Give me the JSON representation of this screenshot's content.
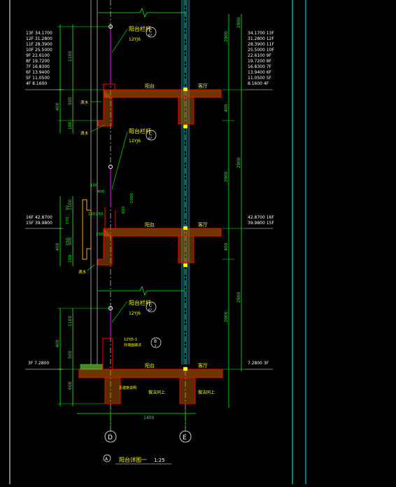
{
  "drawing": {
    "title": "阳台详图一",
    "scale": "1:25",
    "detail_number": "A",
    "colors": {
      "background": "#000000",
      "dimension": "#00ff00",
      "wall_outline": "#ff0000",
      "hatch": "#c86400",
      "label": "#ffff00",
      "axis": "#ffffff",
      "cyan": "#00ffff",
      "magenta": "#ff00ff",
      "blue_line": "#4080ff"
    }
  },
  "levels_left_upper": [
    "13F 34.1700",
    "12F 31.2800",
    "11F 28.3900",
    "10F 25.5000",
    "9F 22.6100",
    "8F 19.7200",
    "7F 16.8300",
    "6F 13.9400",
    "5F 11.0500",
    "4F 8.1600"
  ],
  "levels_right_upper": [
    "34.1700 13F",
    "31.2800 12F",
    "28.3900 11F",
    "25.5000 10F",
    "22.6100 9F",
    "19.7200 8F",
    "16.8300 7F",
    "13.9400 6F",
    "11.0500 5F",
    "8.1600 4F"
  ],
  "levels_left_mid": [
    "16F 42.8700",
    "15F 39.9800"
  ],
  "levels_right_mid": [
    "42.8700 16F",
    "39.9800 15F"
  ],
  "level_bottom_left": "3F 7.2800",
  "level_bottom_right": "7.2800 3F",
  "labels": {
    "railing_1": "阳台栏杆",
    "railing_1_ref": "12YJ6",
    "railing_2": "阳台栏杆",
    "railing_2_ref": "12YJ6",
    "railing_3": "阳台栏杆",
    "railing_3_ref": "12YJ6",
    "balcony_1": "阳台",
    "living_1": "客厅",
    "balcony_2": "阳台",
    "living_2": "客厅",
    "balcony_3": "阳台",
    "living_3": "客厅",
    "drain_1": "滴水",
    "drain_2": "滴水",
    "drain_3": "滴水",
    "bottom_detail": "12YJ5-1",
    "bottom_detail_2": "外墙面做法",
    "ceiling_1": "见建施说明",
    "ceiling_2": "做法同上",
    "ceiling_3": "做法同上",
    "circle_ref_top": "C",
    "circle_ref_top_sub": "67",
    "circle_ref_mid": "C",
    "circle_ref_mid_sub": "67",
    "circle_ref_bot": "C",
    "circle_ref_bot_sub": "67",
    "circle_ref_b": "B",
    "circle_ref_b_sub": "2"
  },
  "dimensions": {
    "right_top": "2900",
    "right_mid": "2900",
    "right_bot": "2900",
    "right_vert_1": "2900",
    "right_vert_2": "2900",
    "right_vert_3": "2900",
    "right_slab_1": "400",
    "right_slab_2": "400",
    "left_1100_a": "1100",
    "left_500_a": "500",
    "left_400_a": "400",
    "left_100_a": "100",
    "left_1100_b": "1100",
    "left_500_b": "500",
    "left_400_b": "400",
    "left_100_b": "100",
    "left_1100_c": "1100",
    "left_500_c": "500",
    "left_400_c": "400",
    "left_100_c": "100",
    "top_100": "100",
    "top_400": "400",
    "top_120": "120",
    "top_250": "250",
    "mid_250": "250",
    "mid_600": "600",
    "mid_1000": "1000",
    "mid_150": "150",
    "mid_170": "170",
    "mid_90": "90",
    "bottom_width": "1400",
    "bottom_600": "600",
    "axis_d": "D",
    "axis_e": "E"
  }
}
